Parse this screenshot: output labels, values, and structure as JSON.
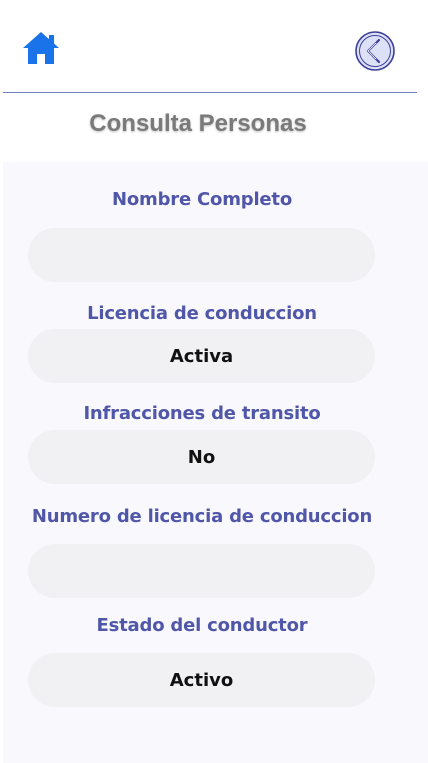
{
  "header": {
    "home_icon": "home-icon",
    "back_icon": "chevron-left-circle-icon",
    "accent": "#1a73e8"
  },
  "title": "Consulta Personas",
  "form": {
    "fields": [
      {
        "label": "Nombre Completo",
        "value": ""
      },
      {
        "label": "Licencia de conduccion",
        "value": "Activa"
      },
      {
        "label": "Infracciones de transito",
        "value": "No"
      },
      {
        "label": "Numero de licencia de conduccion",
        "value": ""
      },
      {
        "label": "Estado del conductor",
        "value": "Activo"
      }
    ]
  }
}
